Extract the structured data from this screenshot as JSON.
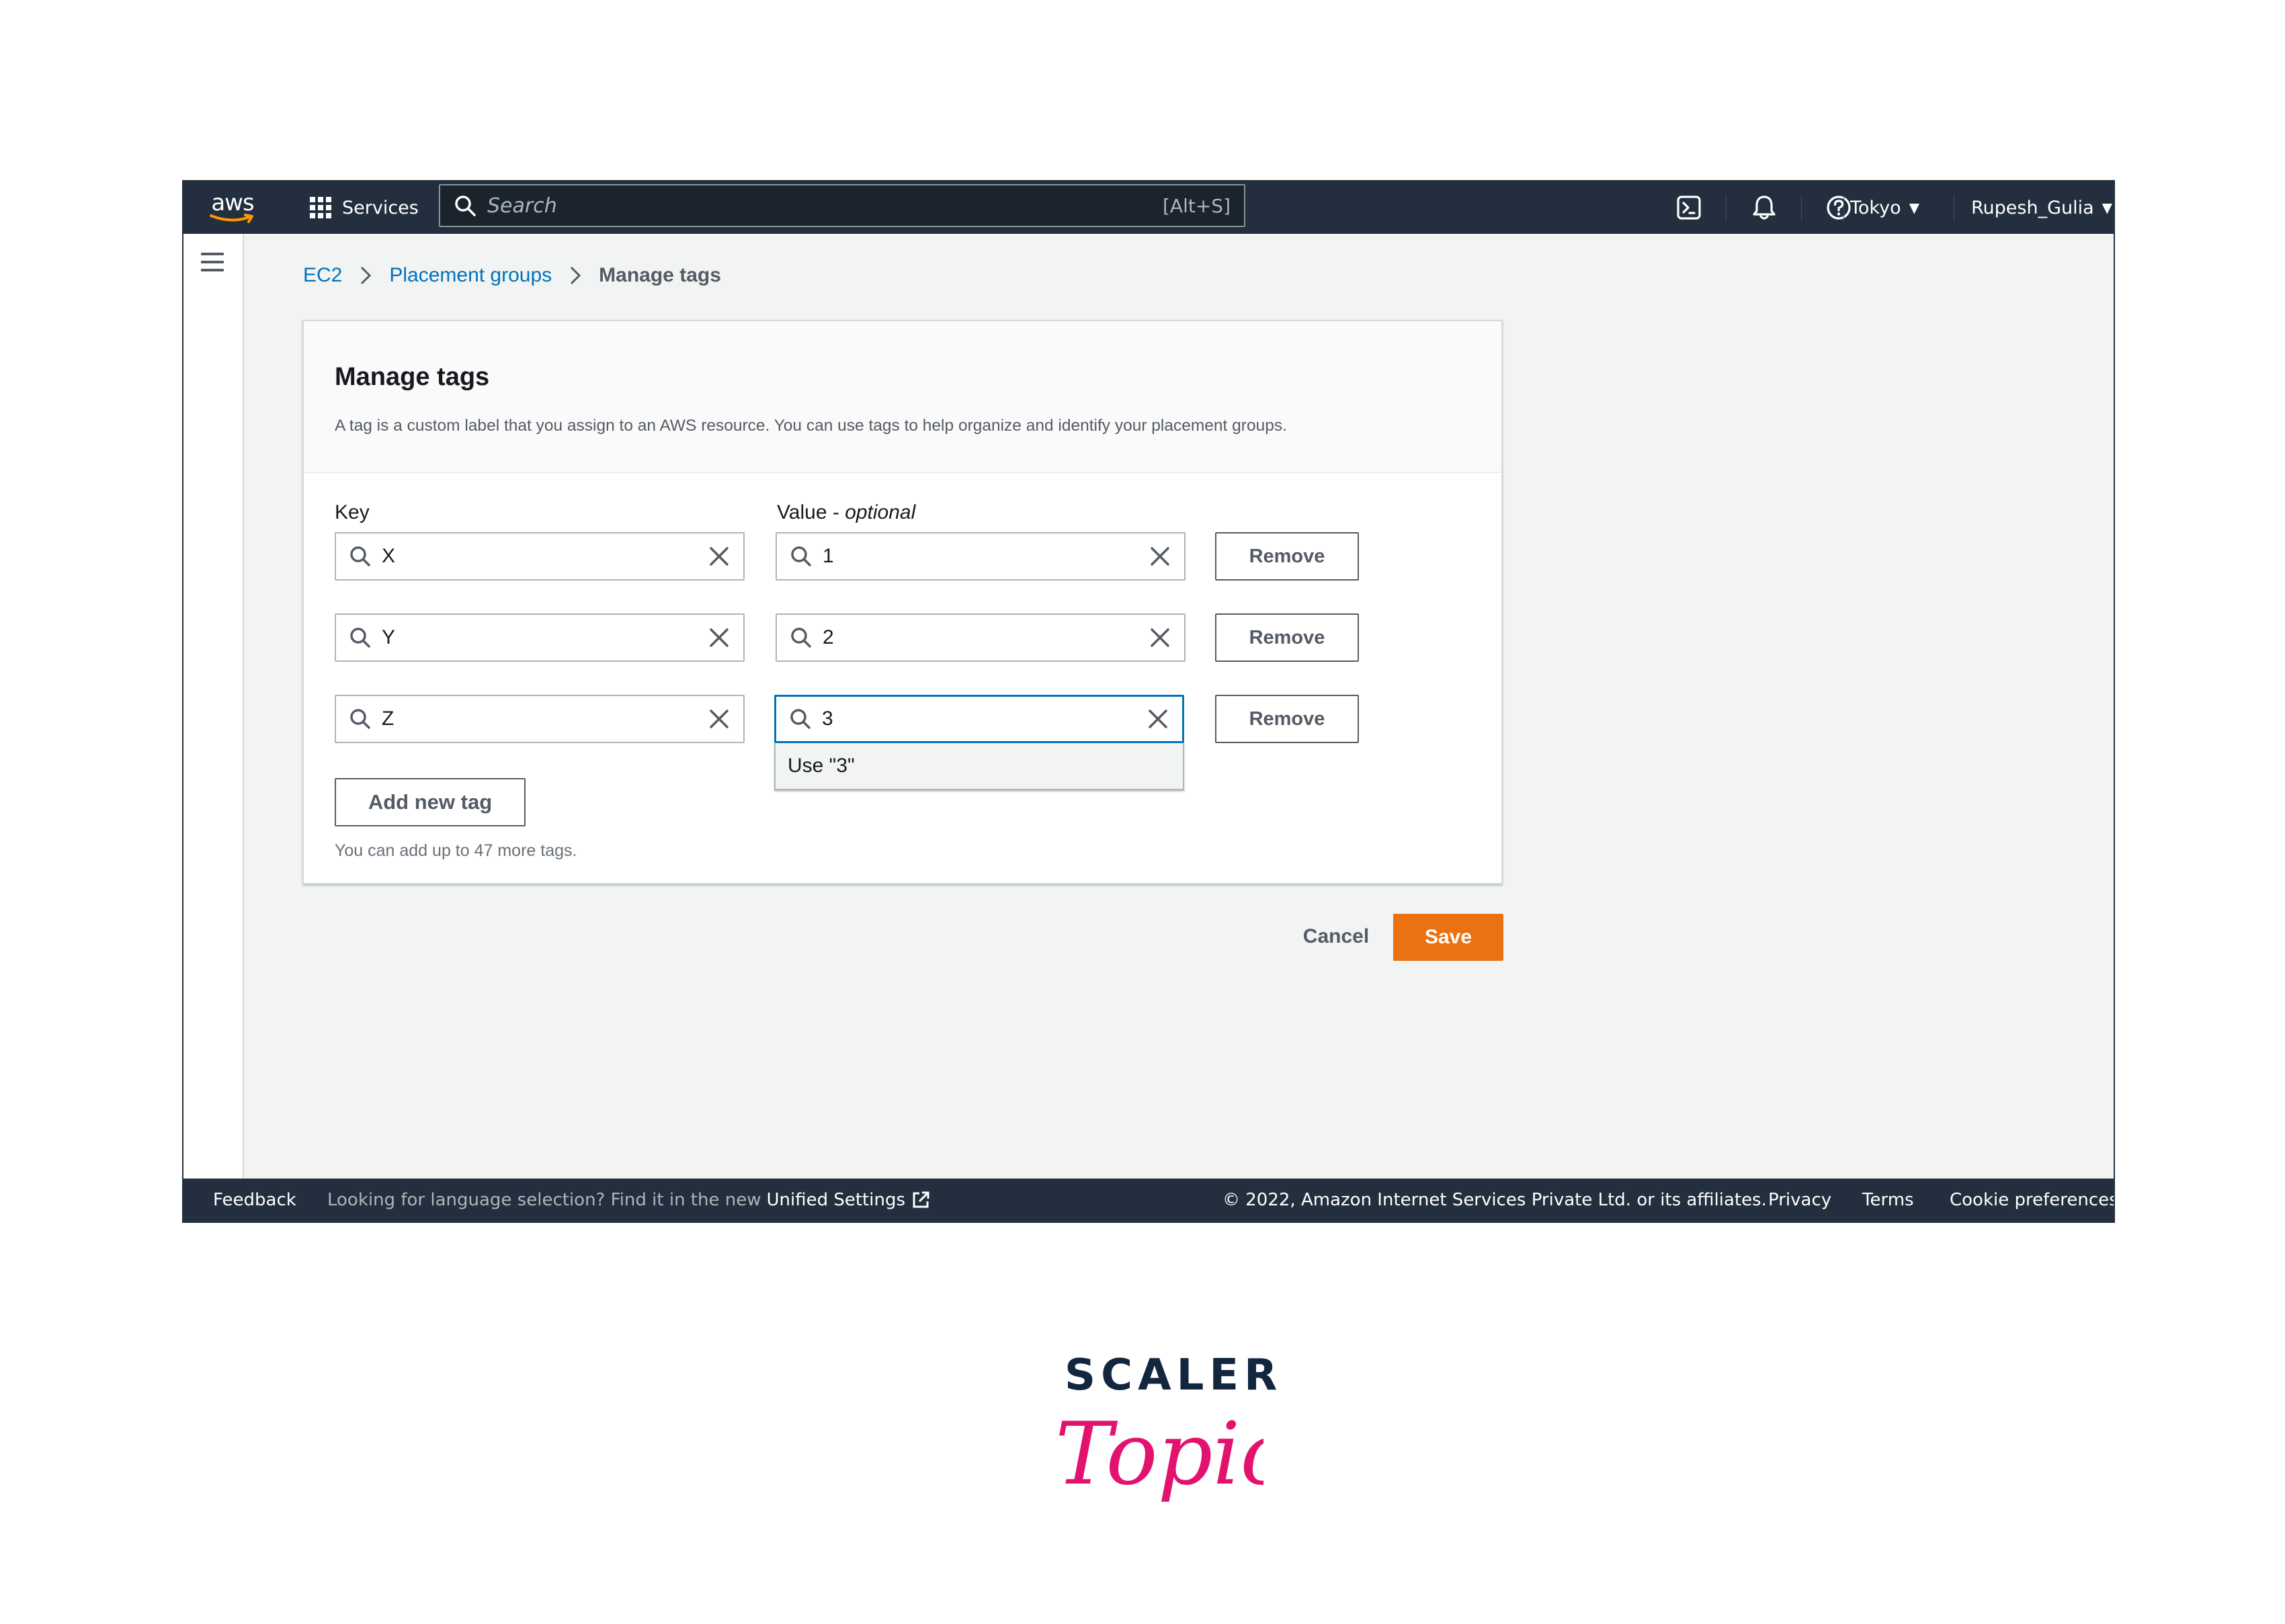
{
  "topnav": {
    "logo": "aws",
    "services_label": "Services",
    "search_placeholder": "Search",
    "search_shortcut": "[Alt+S]",
    "region": "Tokyo",
    "user": "Rupesh_Gulia"
  },
  "breadcrumb": {
    "items": [
      "EC2",
      "Placement groups"
    ],
    "current": "Manage tags"
  },
  "card": {
    "title": "Manage tags",
    "description": "A tag is a custom label that you assign to an AWS resource. You can use tags to help organize and identify your placement groups.",
    "key_label": "Key",
    "value_label": "Value",
    "value_optional": "optional",
    "value_separator": " - ",
    "tags": [
      {
        "key": "X",
        "value": "1"
      },
      {
        "key": "Y",
        "value": "2"
      },
      {
        "key": "Z",
        "value": "3"
      }
    ],
    "remove_label": "Remove",
    "suggestion": "Use \"3\"",
    "add_button": "Add new tag",
    "hint": "You can add up to 47 more tags."
  },
  "actions": {
    "cancel": "Cancel",
    "save": "Save"
  },
  "footer": {
    "feedback": "Feedback",
    "language_note": "Looking for language selection? Find it in the new",
    "unified_settings": "Unified Settings",
    "copyright": "© 2022, Amazon Internet Services Private Ltd. or its affiliates.",
    "privacy": "Privacy",
    "terms": "Terms",
    "cookies": "Cookie preferences"
  },
  "brand": {
    "line1": "SCALER",
    "line2": "Topics"
  },
  "colors": {
    "nav_bg": "#232f3e",
    "link": "#0073bb",
    "primary": "#ec7211",
    "focus": "#0073bb",
    "brand_navy": "#13263f",
    "brand_pink": "#e2136e"
  }
}
